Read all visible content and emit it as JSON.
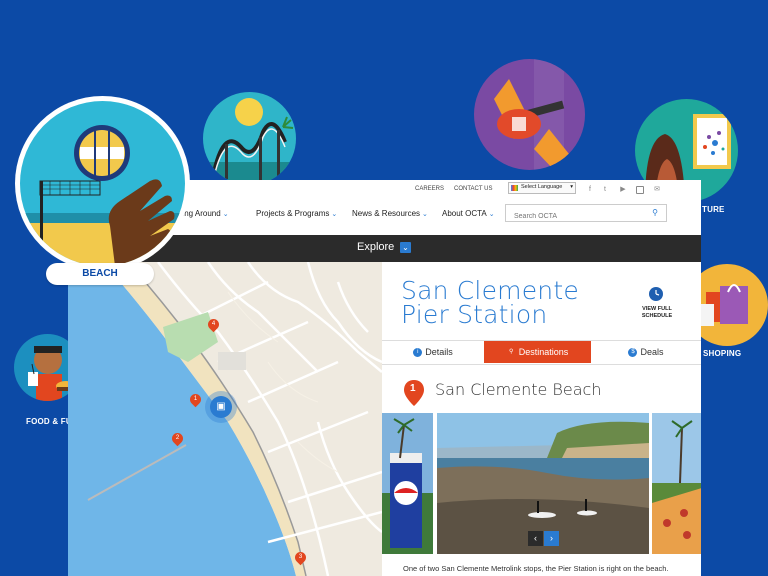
{
  "colors": {
    "background": "#0c4aa6",
    "accent_blue": "#2a7bd1",
    "accent_red": "#e2461f",
    "dark_bar": "#2b2b2b"
  },
  "categories": {
    "beach": "BEACH",
    "food": "FOOD & FU",
    "culture": "TURE",
    "shopping": "SHOPING"
  },
  "header": {
    "careers": "CAREERS",
    "contact": "CONTACT US",
    "language": "Select Language",
    "social_icons": [
      "facebook-icon",
      "twitter-icon",
      "youtube-icon",
      "instagram-icon",
      "email-icon"
    ],
    "nav": [
      "tting Around",
      "Projects & Programs",
      "News & Resources",
      "About OCTA"
    ],
    "search_placeholder": "Search OCTA"
  },
  "explore": {
    "label": "Explore"
  },
  "map": {
    "markers": [
      "4",
      "1",
      "2",
      "3"
    ]
  },
  "station": {
    "title": "San Clemente Pier Station",
    "schedule_label": "VIEW FULL SCHEDULE",
    "tabs": [
      {
        "label": "Details",
        "icon": "i"
      },
      {
        "label": "Destinations",
        "icon": "pin"
      },
      {
        "label": "Deals",
        "icon": "$"
      }
    ],
    "destination_number": "1",
    "destination_title": "San Clemente Beach",
    "description": "One of two San Clemente Metrolink stops, the Pier Station is right on the beach."
  }
}
